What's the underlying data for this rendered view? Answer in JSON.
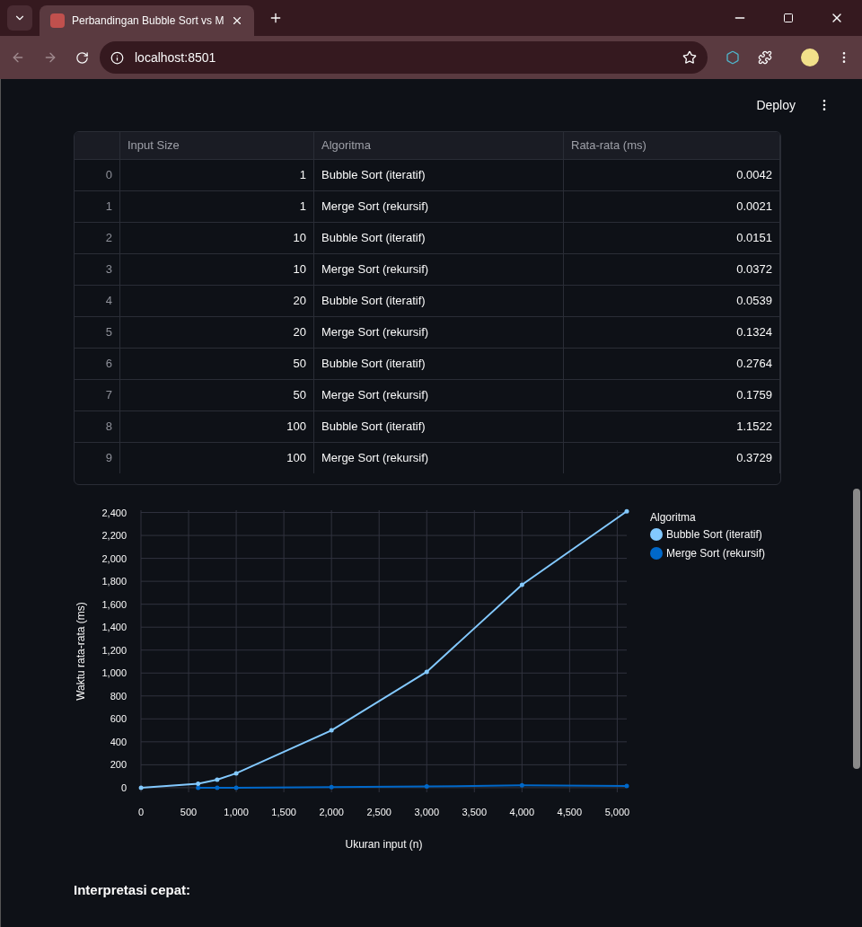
{
  "browser": {
    "tab_title": "Perbandingan Bubble Sort vs M",
    "url": "localhost:8501"
  },
  "header": {
    "deploy": "Deploy"
  },
  "table": {
    "columns": [
      "",
      "Input Size",
      "Algoritma",
      "Rata-rata (ms)"
    ],
    "rows": [
      [
        "0",
        "1",
        "Bubble Sort (iteratif)",
        "0.0042"
      ],
      [
        "1",
        "1",
        "Merge Sort (rekursif)",
        "0.0021"
      ],
      [
        "2",
        "10",
        "Bubble Sort (iteratif)",
        "0.0151"
      ],
      [
        "3",
        "10",
        "Merge Sort (rekursif)",
        "0.0372"
      ],
      [
        "4",
        "20",
        "Bubble Sort (iteratif)",
        "0.0539"
      ],
      [
        "5",
        "20",
        "Merge Sort (rekursif)",
        "0.1324"
      ],
      [
        "6",
        "50",
        "Bubble Sort (iteratif)",
        "0.2764"
      ],
      [
        "7",
        "50",
        "Merge Sort (rekursif)",
        "0.1759"
      ],
      [
        "8",
        "100",
        "Bubble Sort (iteratif)",
        "1.1522"
      ],
      [
        "9",
        "100",
        "Merge Sort (rekursif)",
        "0.3729"
      ]
    ]
  },
  "chart": {
    "chart_data": {
      "type": "line",
      "xlabel": "Ukuran input (n)",
      "ylabel": "Waktu rata-rata (ms)",
      "grid": true,
      "legend": {
        "title": "Algoritma"
      },
      "x": [
        1,
        600,
        800,
        1000,
        2000,
        3000,
        4000,
        5100
      ],
      "series": [
        {
          "name": "Bubble Sort (iteratif)",
          "color": "#83c9ff",
          "marker": true,
          "values": [
            0,
            35,
            70,
            125,
            500,
            1010,
            1770,
            2410
          ]
        },
        {
          "name": "Merge Sort (rekursif)",
          "color": "#0068c9",
          "marker": true,
          "values": [
            null,
            0,
            0,
            0,
            5,
            10,
            20,
            15
          ]
        }
      ],
      "xlim": [
        0,
        5100
      ],
      "ylim": [
        -40,
        2420
      ],
      "xticks": [
        {
          "value": 0,
          "label": "0"
        },
        {
          "value": 500,
          "label": "500"
        },
        {
          "value": 1000,
          "label": "1,000"
        },
        {
          "value": 1500,
          "label": "1,500"
        },
        {
          "value": 2000,
          "label": "2,000"
        },
        {
          "value": 2500,
          "label": "2,500"
        },
        {
          "value": 3000,
          "label": "3,000"
        },
        {
          "value": 3500,
          "label": "3,500"
        },
        {
          "value": 4000,
          "label": "4,000"
        },
        {
          "value": 4500,
          "label": "4,500"
        },
        {
          "value": 5000,
          "label": "5,000"
        }
      ],
      "yticks": [
        {
          "value": 0,
          "label": "0"
        },
        {
          "value": 200,
          "label": "200"
        },
        {
          "value": 400,
          "label": "400"
        },
        {
          "value": 600,
          "label": "600"
        },
        {
          "value": 800,
          "label": "800"
        },
        {
          "value": 1000,
          "label": "1,000"
        },
        {
          "value": 1200,
          "label": "1,200"
        },
        {
          "value": 1400,
          "label": "1,400"
        },
        {
          "value": 1600,
          "label": "1,600"
        },
        {
          "value": 1800,
          "label": "1,800"
        },
        {
          "value": 2000,
          "label": "2,000"
        },
        {
          "value": 2200,
          "label": "2,200"
        },
        {
          "value": 2400,
          "label": "2,400"
        }
      ]
    }
  },
  "interpretation": {
    "heading": "Interpretasi cepat:"
  }
}
